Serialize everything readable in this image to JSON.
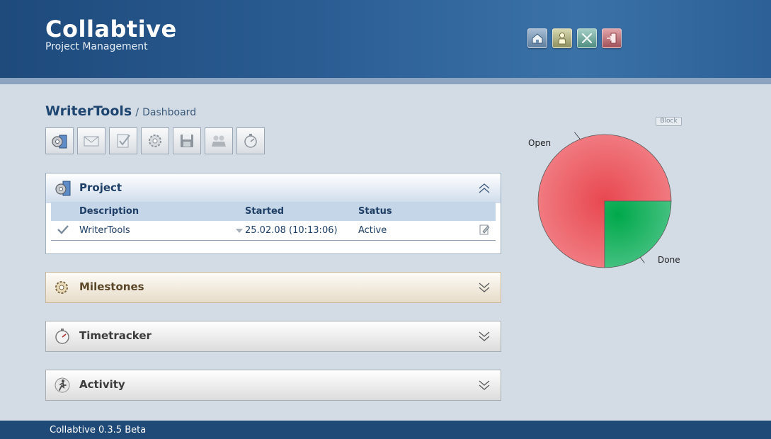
{
  "app": {
    "title": "Collabtive",
    "subtitle": "Project Management"
  },
  "topnav": [
    "home-icon",
    "user-icon",
    "admin-icon",
    "logout-icon"
  ],
  "breadcrumb": {
    "project": "WriterTools",
    "separator": "/",
    "page": "Dashboard"
  },
  "toolbar": [
    "project-settings-icon",
    "messages-icon",
    "tasks-icon",
    "milestones-icon",
    "files-icon",
    "users-icon",
    "timetracker-icon"
  ],
  "project_panel": {
    "title": "Project",
    "columns": {
      "description": "Description",
      "started": "Started",
      "status": "Status"
    },
    "row": {
      "description": "WriterTools",
      "started": "25.02.08 (10:13:06)",
      "status": "Active"
    }
  },
  "panels": {
    "milestones": "Milestones",
    "timetracker": "Timetracker",
    "activity": "Activity"
  },
  "block_label": "Block",
  "chart_data": {
    "type": "pie",
    "labels": [
      "Open",
      "Done"
    ],
    "values": [
      75,
      25
    ],
    "colors": [
      "#ee5a62",
      "#19a85a"
    ]
  },
  "footer": {
    "text": "Collabtive 0.3.5 Beta"
  },
  "colors": {
    "header": "#1e4a7c",
    "footer": "#1f4a78",
    "accent": "#1f4670",
    "status_active": "#1e8a1e"
  }
}
